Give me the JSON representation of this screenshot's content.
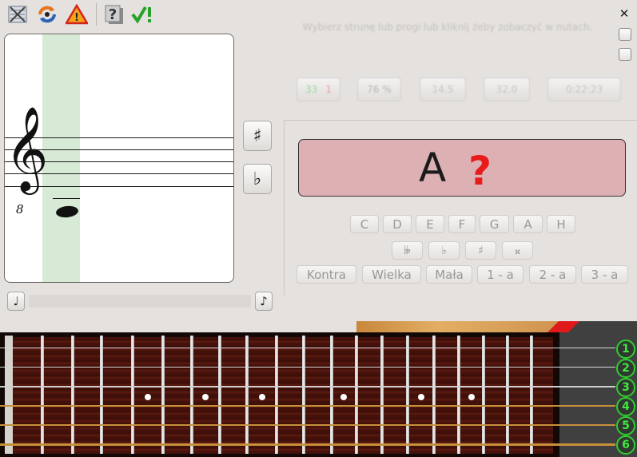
{
  "toolbar": {
    "items": [
      {
        "name": "settings-icon",
        "glyph": "✕"
      },
      {
        "name": "levels-icon",
        "glyph": "⟳"
      },
      {
        "name": "start-icon",
        "glyph": "⚠"
      },
      {
        "name": "help-icon",
        "glyph": "?"
      },
      {
        "name": "check-answer-icon",
        "glyph": "✔!"
      }
    ]
  },
  "window": {
    "close_glyph": "✕"
  },
  "hint": {
    "text": "Wybierz strunę lub progi lub kliknij żeby zobaczyć w nutach."
  },
  "stats": [
    {
      "name": "stat-answers",
      "value": "33   1"
    },
    {
      "name": "stat-effectiveness",
      "value": "76 %"
    },
    {
      "name": "stat-average",
      "value": "14.5"
    },
    {
      "name": "stat-time-answer",
      "value": "32.0"
    },
    {
      "name": "stat-total-time",
      "value": "0:22:23"
    }
  ],
  "score": {
    "clef": "𝄞",
    "clef_octave": "8"
  },
  "accidentals": {
    "sharp": "♯",
    "flat": "♭"
  },
  "score_controls": {
    "left_glyph": "♩",
    "right_glyph": "♪"
  },
  "answer": {
    "note": "A",
    "mark": "?",
    "mark_color": "#e81a1a",
    "bg": "#ddb0b4"
  },
  "notes": [
    "C",
    "D",
    "E",
    "F",
    "G",
    "A",
    "H"
  ],
  "accidental_buttons": [
    "𝄫",
    "♭",
    "♯",
    "𝄪"
  ],
  "octaves": [
    "Kontra",
    "Wielka",
    "Mała",
    "1 - a",
    "2 - a",
    "3 - a"
  ],
  "fretboard": {
    "strings": [
      "1",
      "2",
      "3",
      "4",
      "5",
      "6"
    ],
    "marker_color": "#2ecf2e"
  }
}
